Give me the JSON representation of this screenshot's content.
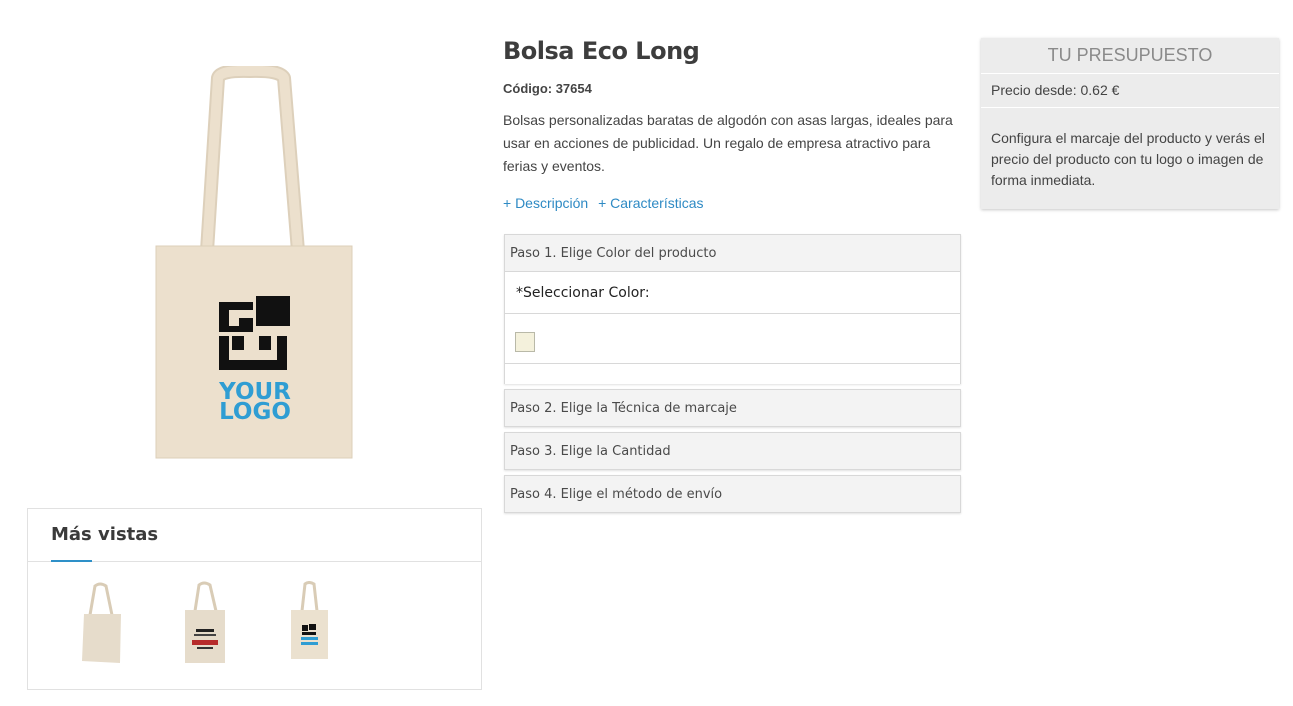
{
  "product": {
    "title": "Bolsa Eco Long",
    "code": "Código: 37654",
    "description": "Bolsas personalizadas baratas de algodón con asas largas, ideales para usar en acciones de publicidad. Un regalo de empresa atractivo para ferias y eventos.",
    "description_link": "+ Descripción",
    "features_link": "+ Características",
    "logo_text_line1": "YOUR",
    "logo_text_line2": "LOGO"
  },
  "more_views": {
    "title": "Más vistas",
    "thumbnails": [
      "bag-plain",
      "bag-printed-your-logo-banner",
      "bag-your-logo"
    ]
  },
  "steps": {
    "step1": "Paso 1. Elige Color del producto",
    "color_label": "*Seleccionar Color:",
    "swatch_color": "#f4f1dc",
    "step2": "Paso 2. Elige la Técnica de marcaje",
    "step3": "Paso 3. Elige la Cantidad",
    "step4": "Paso 4. Elige el método de envío"
  },
  "budget": {
    "title": "TU PRESUPUESTO",
    "price": "Precio desde: 0.62 €",
    "text": "Configura el marcaje del producto y verás el precio del producto con tu logo o imagen de forma inmediata."
  },
  "colors": {
    "bag": "#ece0cd",
    "logo_blue": "#2f9dd3",
    "link_blue": "#2e8ac4",
    "accent_underline": "#2e90c8"
  }
}
